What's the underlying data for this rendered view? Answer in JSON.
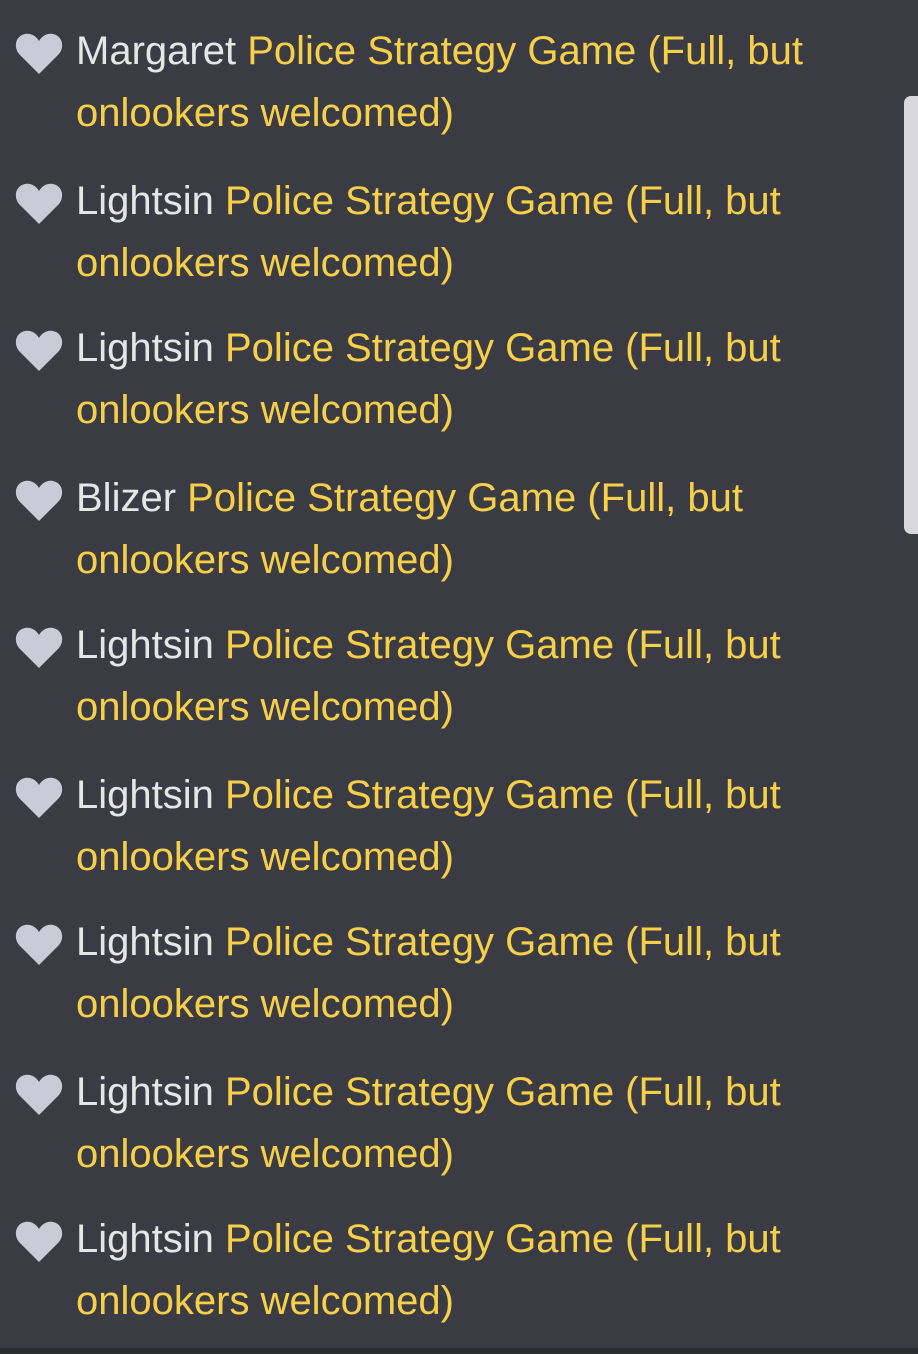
{
  "colors": {
    "background": "#3b3c43",
    "username": "#e6e6e6",
    "game_title": "#f7d04a",
    "heart": "#c9ccd6"
  },
  "entries": [
    {
      "icon": "heart-icon",
      "user": "Margaret",
      "game": "Police Strategy Game (Full, but onlookers welcomed)"
    },
    {
      "icon": "heart-icon",
      "user": "Lightsin",
      "game": "Police Strategy Game (Full, but onlookers welcomed)"
    },
    {
      "icon": "heart-icon",
      "user": "Lightsin",
      "game": "Police Strategy Game (Full, but onlookers welcomed)"
    },
    {
      "icon": "heart-icon",
      "user": "Blizer",
      "game": "Police Strategy Game (Full, but onlookers welcomed)"
    },
    {
      "icon": "heart-icon",
      "user": "Lightsin",
      "game": "Police Strategy Game (Full, but onlookers welcomed)"
    },
    {
      "icon": "heart-icon",
      "user": "Lightsin",
      "game": "Police Strategy Game (Full, but onlookers welcomed)"
    },
    {
      "icon": "heart-icon",
      "user": "Lightsin",
      "game": "Police Strategy Game (Full, but onlookers welcomed)"
    },
    {
      "icon": "heart-icon",
      "user": "Lightsin",
      "game": "Police Strategy Game (Full, but onlookers welcomed)"
    },
    {
      "icon": "heart-icon",
      "user": "Lightsin",
      "game": "Police Strategy Game (Full, but onlookers welcomed)"
    }
  ]
}
